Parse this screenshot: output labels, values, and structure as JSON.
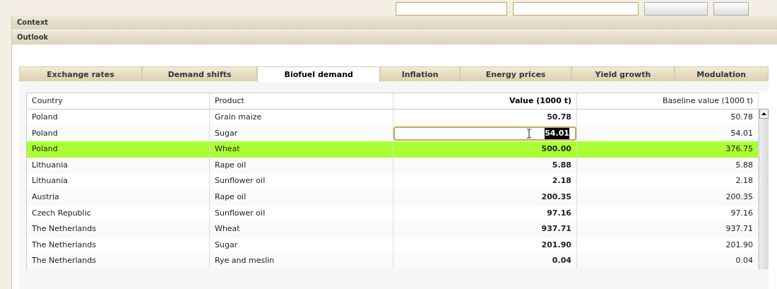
{
  "sections": [
    {
      "label": "Context"
    },
    {
      "label": "Outlook"
    }
  ],
  "tabs": [
    {
      "label": "Exchange rates",
      "selected": false
    },
    {
      "label": "Demand shifts",
      "selected": false
    },
    {
      "label": "Biofuel demand",
      "selected": true
    },
    {
      "label": "Inflation",
      "selected": false
    },
    {
      "label": "Energy prices",
      "selected": false
    },
    {
      "label": "Yield growth",
      "selected": false
    },
    {
      "label": "Modulation",
      "selected": false
    }
  ],
  "table": {
    "columns": [
      "Country",
      "Product",
      "Value (1000 t)",
      "Baseline value (1000 t)"
    ],
    "rows": [
      {
        "cells": [
          "Poland",
          "Grain maize",
          "50.78",
          "50.78"
        ],
        "selected": false,
        "editing": false
      },
      {
        "cells": [
          "Poland",
          "Sugar",
          "54.01",
          "54.01"
        ],
        "selected": false,
        "editing": true
      },
      {
        "cells": [
          "Poland",
          "Wheat",
          "500.00",
          "376.75"
        ],
        "selected": true,
        "editing": false
      },
      {
        "cells": [
          "Lithuania",
          "Rape oil",
          "5.88",
          "5.88"
        ],
        "selected": false,
        "editing": false
      },
      {
        "cells": [
          "Lithuania",
          "Sunflower oil",
          "2.18",
          "2.18"
        ],
        "selected": false,
        "editing": false
      },
      {
        "cells": [
          "Austria",
          "Rape oil",
          "200.35",
          "200.35"
        ],
        "selected": false,
        "editing": false
      },
      {
        "cells": [
          "Czech Republic",
          "Sunflower oil",
          "97.16",
          "97.16"
        ],
        "selected": false,
        "editing": false
      },
      {
        "cells": [
          "The Netherlands",
          "Wheat",
          "937.71",
          "937.71"
        ],
        "selected": false,
        "editing": false
      },
      {
        "cells": [
          "The Netherlands",
          "Sugar",
          "201.90",
          "201.90"
        ],
        "selected": false,
        "editing": false
      },
      {
        "cells": [
          "The Netherlands",
          "Rye and meslin",
          "0.04",
          "0.04"
        ],
        "selected": false,
        "editing": false
      }
    ]
  }
}
